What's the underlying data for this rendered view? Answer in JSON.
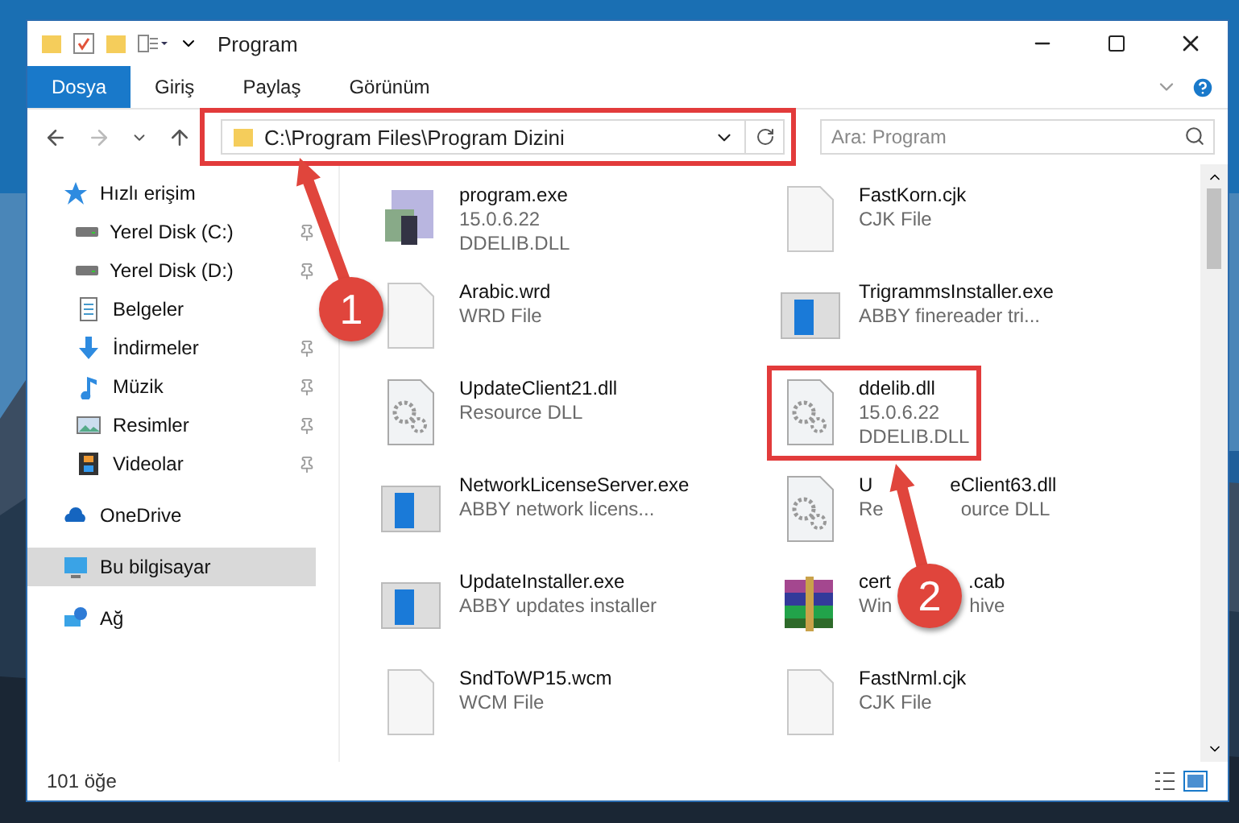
{
  "window": {
    "title": "Program"
  },
  "ribbon_tabs": [
    {
      "label": "Dosya",
      "selected": true
    },
    {
      "label": "Giriş",
      "selected": false
    },
    {
      "label": "Paylaş",
      "selected": false
    },
    {
      "label": "Görünüm",
      "selected": false
    }
  ],
  "address_bar": {
    "path": "C:\\Program Files\\Program Dizini",
    "highlighted": true
  },
  "search": {
    "placeholder": "Ara: Program"
  },
  "sidebar": {
    "items": [
      {
        "label": "Hızlı erişim",
        "selected": false,
        "children": [
          {
            "label": "Yerel Disk (C:)",
            "pinned": true,
            "selected": false
          },
          {
            "label": "Yerel Disk (D:)",
            "pinned": true,
            "selected": false
          },
          {
            "label": "Belgeler",
            "pinned": false,
            "selected": false
          },
          {
            "label": "İndirmeler",
            "pinned": true,
            "selected": false
          },
          {
            "label": "Müzik",
            "pinned": true,
            "selected": false
          },
          {
            "label": "Resimler",
            "pinned": true,
            "selected": false
          },
          {
            "label": "Videolar",
            "pinned": true,
            "selected": false
          }
        ]
      },
      {
        "label": "OneDrive",
        "selected": false
      },
      {
        "label": "Bu bilgisayar",
        "selected": true
      },
      {
        "label": "Ağ",
        "selected": false
      }
    ]
  },
  "files": [
    {
      "highlighted": false,
      "lines": [
        "program.exe",
        "15.0.6.22",
        "DDELIB.DLL"
      ]
    },
    {
      "highlighted": false,
      "lines": [
        "FastKorn.cjk",
        "CJK File"
      ]
    },
    {
      "highlighted": false,
      "lines": [
        "Arabic.wrd",
        "WRD File"
      ]
    },
    {
      "highlighted": false,
      "lines": [
        "TrigrammsInstaller.exe",
        "ABBY finereader tri..."
      ]
    },
    {
      "highlighted": false,
      "lines": [
        "UpdateClient21.dll",
        "Resource DLL"
      ]
    },
    {
      "highlighted": true,
      "lines": [
        "ddelib.dll",
        "15.0.6.22",
        "DDELIB.DLL"
      ]
    },
    {
      "highlighted": false,
      "lines": [
        "NetworkLicenseServer.exe",
        "ABBY network licens..."
      ]
    },
    {
      "highlighted": false,
      "lines": [
        [
          "U",
          "eClient63.dll"
        ],
        [
          "Re",
          "ource DLL"
        ]
      ]
    },
    {
      "highlighted": false,
      "lines": [
        "UpdateInstaller.exe",
        "ABBY updates installer"
      ]
    },
    {
      "highlighted": false,
      "lines": [
        [
          "cert",
          ".cab"
        ],
        [
          "Win",
          "hive"
        ]
      ]
    },
    {
      "highlighted": false,
      "lines": [
        "SndToWP15.wcm",
        "WCM File"
      ]
    },
    {
      "highlighted": false,
      "lines": [
        "FastNrml.cjk",
        "CJK File"
      ]
    }
  ],
  "status_bar": {
    "count": "101 öğe"
  },
  "annotations": [
    {
      "number": "1"
    },
    {
      "number": "2"
    }
  ]
}
